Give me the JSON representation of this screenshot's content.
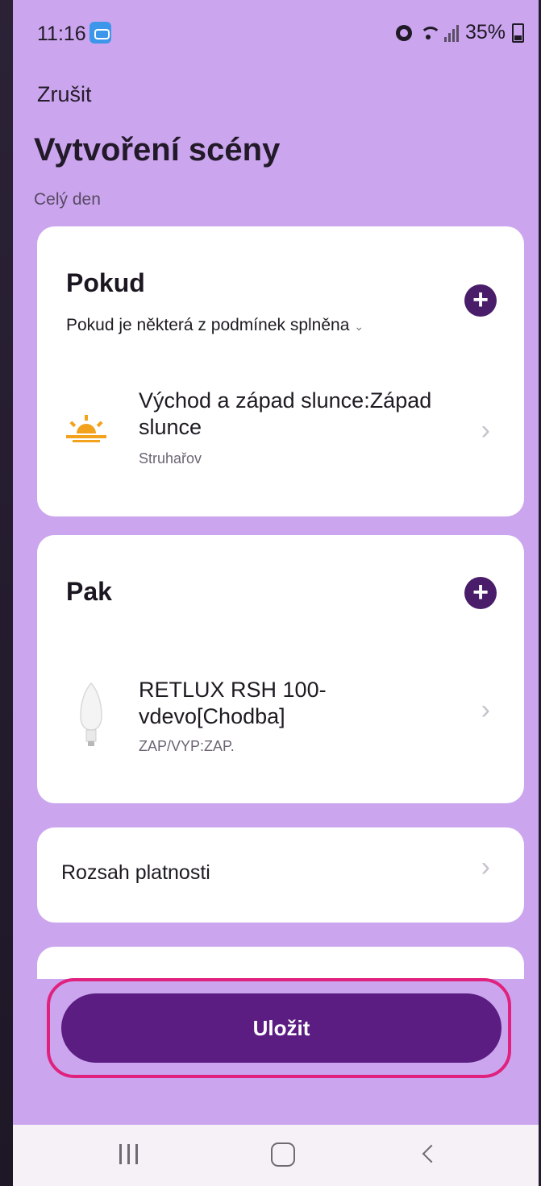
{
  "status_bar": {
    "time": "11:16",
    "battery": "35%"
  },
  "header": {
    "cancel_label": "Zrušit",
    "title": "Vytvoření scény",
    "subtitle": "Celý den"
  },
  "if_section": {
    "title": "Pokud",
    "condition_type": "Pokud je některá z podmínek splněna",
    "condition": {
      "title": "Východ a západ slunce:Západ slunce",
      "subtitle": "Struhařov",
      "icon": "sunset-icon"
    }
  },
  "then_section": {
    "title": "Pak",
    "action": {
      "title": "RETLUX RSH 100-vdevo[Chodba]",
      "subtitle": "ZAP/VYP:ZAP.",
      "icon": "light-bulb-icon"
    }
  },
  "scope": {
    "label": "Rozsah platnosti"
  },
  "save_button_label": "Uložit",
  "colors": {
    "background": "#cba5ee",
    "primary": "#5b1d82",
    "highlight": "#e0217d",
    "sun": "#f2a21c"
  }
}
